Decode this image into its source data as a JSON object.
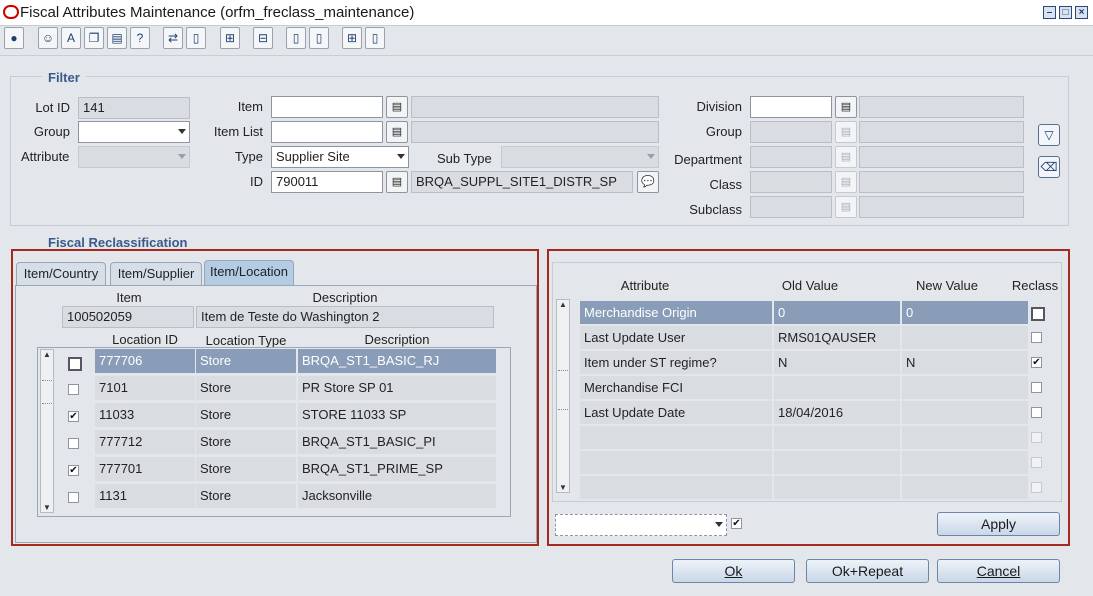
{
  "window": {
    "title": "Fiscal Attributes Maintenance  (orfm_freclass_maintenance)",
    "controls": [
      "minimize-icon",
      "maximize-icon",
      "close-icon"
    ]
  },
  "toolbar": {
    "icons": [
      "globe-icon",
      "smile-icon",
      "spellcheck-icon",
      "copy-icon",
      "print-icon",
      "help-icon",
      "navigate-icon",
      "new-record-icon",
      "tree-expand-icon",
      "tree-collapse-icon",
      "new-document-icon",
      "new-document-2-icon",
      "tree-icon",
      "document-icon"
    ]
  },
  "filter": {
    "section_label": "Filter",
    "lot_id_label": "Lot ID",
    "lot_id_value": "141",
    "group_label": "Group",
    "group_value": "",
    "attribute_label": "Attribute",
    "attribute_value": "",
    "item_label": "Item",
    "item_value": "",
    "item_desc": "",
    "item_list_label": "Item List",
    "item_list_value": "",
    "type_label": "Type",
    "type_value": "Supplier Site",
    "sub_type_label": "Sub Type",
    "sub_type_value": "",
    "id_label": "ID",
    "id_value": "790011",
    "id_desc": "BRQA_SUPPL_SITE1_DISTR_SP",
    "division_label": "Division",
    "merch_group_label": "Group",
    "department_label": "Department",
    "class_label": "Class",
    "subclass_label": "Subclass"
  },
  "fiscal": {
    "section_label": "Fiscal Reclassification",
    "tabs": [
      "Item/Country",
      "Item/Supplier",
      "Item/Location"
    ],
    "active_tab": "Item/Location",
    "item_header": "Item",
    "description_header": "Description",
    "item_value": "100502059",
    "item_desc": "Item de Teste do Washington 2",
    "loc_headers": [
      "Location ID",
      "Location Type",
      "Description"
    ],
    "locations": [
      {
        "id": "777706",
        "type": "Store",
        "desc": "BRQA_ST1_BASIC_RJ",
        "checked": false,
        "selected": true
      },
      {
        "id": "7101",
        "type": "Store",
        "desc": "PR Store SP 01",
        "checked": false,
        "selected": false
      },
      {
        "id": "11033",
        "type": "Store",
        "desc": "STORE 11033 SP",
        "checked": true,
        "selected": false
      },
      {
        "id": "777712",
        "type": "Store",
        "desc": "BRQA_ST1_BASIC_PI",
        "checked": false,
        "selected": false
      },
      {
        "id": "777701",
        "type": "Store",
        "desc": "BRQA_ST1_PRIME_SP",
        "checked": true,
        "selected": false
      },
      {
        "id": "1131",
        "type": "Store",
        "desc": "Jacksonville",
        "checked": false,
        "selected": false
      }
    ]
  },
  "attributes": {
    "headers": [
      "Attribute",
      "Old Value",
      "New Value",
      "Reclass"
    ],
    "rows": [
      {
        "attr": "Merchandise Origin",
        "old": "0",
        "new": "0",
        "reclass": false,
        "selected": true
      },
      {
        "attr": "Last Update User",
        "old": "RMS01QAUSER",
        "new": "",
        "reclass": false,
        "selected": false
      },
      {
        "attr": "Item under ST regime?",
        "old": "N",
        "new": "N",
        "reclass": true,
        "selected": false
      },
      {
        "attr": "Merchandise FCI",
        "old": "",
        "new": "",
        "reclass": false,
        "selected": false
      },
      {
        "attr": "Last Update Date",
        "old": "18/04/2016",
        "new": "",
        "reclass": false,
        "selected": false
      },
      {
        "attr": "",
        "old": "",
        "new": "",
        "reclass": false,
        "selected": false
      },
      {
        "attr": "",
        "old": "",
        "new": "",
        "reclass": false,
        "selected": false
      },
      {
        "attr": "",
        "old": "",
        "new": "",
        "reclass": false,
        "selected": false
      }
    ],
    "bottom_select_value": "",
    "bottom_checkbox_checked": true,
    "apply_label": "Apply"
  },
  "footer": {
    "ok_label": "Ok",
    "ok_repeat_label": "Ok+Repeat",
    "cancel_label": "Cancel"
  }
}
